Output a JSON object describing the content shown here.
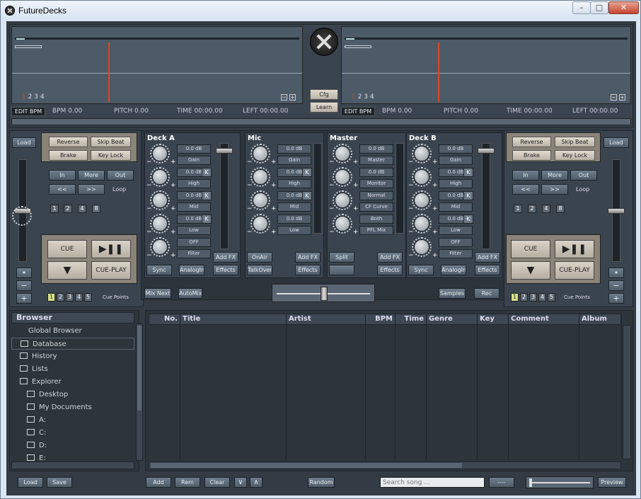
{
  "window": {
    "title": "FutureDecks",
    "min": "–",
    "max": "□",
    "close": "✕"
  },
  "center": {
    "cfg": "Cfg",
    "learn": "Learn"
  },
  "deckLeft": {
    "wave_nums": [
      "1",
      "2",
      "3",
      "4"
    ],
    "edit_bpm": "EDIT BPM",
    "bpm": "BPM  0.00",
    "pitch": "PITCH  0.00",
    "time": "TIME  00:00.00",
    "left": "LEFT  00:00.00",
    "load": "Load",
    "reverse": "Reverse",
    "skip_beat": "Skip Beat",
    "brake": "Brake",
    "key_lock": "Key Lock",
    "in": "In",
    "more": "More",
    "out": "Out",
    "back": "<<",
    "fwd": ">>",
    "loop": "Loop",
    "loops": [
      "1",
      "2",
      "4",
      "8"
    ],
    "cue": "CUE",
    "play": "▶❚❚",
    "stop": "▼",
    "cue_play": "CUE-PLAY",
    "cues": [
      "1",
      "2",
      "3",
      "4",
      "5"
    ],
    "cue_points": "Cue Points",
    "pitch_dot": "•",
    "minus": "−",
    "plus": "+"
  },
  "deckRight": {
    "wave_nums": [
      "1",
      "2",
      "3",
      "4"
    ],
    "edit_bpm": "EDIT BPM",
    "bpm": "BPM  0.00",
    "pitch": "PITCH  0.00",
    "time": "TIME  00:00.00",
    "left": "LEFT  00:00.00",
    "load": "Load",
    "reverse": "Reverse",
    "skip_beat": "Skip Beat",
    "brake": "Brake",
    "key_lock": "Key Lock",
    "in": "In",
    "more": "More",
    "out": "Out",
    "back": "<<",
    "fwd": ">>",
    "loop": "Loop",
    "loops": [
      "1",
      "2",
      "4",
      "8"
    ],
    "cue": "CUE",
    "play": "▶❚❚",
    "stop": "▼",
    "cue_play": "CUE-PLAY",
    "cues": [
      "1",
      "2",
      "3",
      "4",
      "5"
    ],
    "cue_points": "Cue Points",
    "pitch_dot": "•",
    "minus": "−",
    "plus": "+"
  },
  "mixer": {
    "deckA": {
      "title": "Deck A",
      "rows": [
        {
          "val": "0.0 dB",
          "lbl": "Gain"
        },
        {
          "val": "0.0 dB",
          "lbl": "High",
          "k": "K"
        },
        {
          "val": "0.0 dB",
          "lbl": "Mid",
          "k": "K"
        },
        {
          "val": "0.0 dB",
          "lbl": "Low",
          "k": "K"
        },
        {
          "val": "OFF",
          "lbl": "Filter"
        }
      ],
      "add_fx": "Add FX",
      "sync": "Sync",
      "analogin": "AnalogIn",
      "effects": "Effects"
    },
    "mic": {
      "title": "Mic",
      "rows": [
        {
          "val": "0.0 dB",
          "lbl": "Gain"
        },
        {
          "val": "0.0 dB",
          "lbl": "High",
          "k": "K"
        },
        {
          "val": "0.0 dB",
          "lbl": "Mid",
          "k": "K"
        },
        {
          "val": "0.0 dB",
          "lbl": "Low"
        }
      ],
      "onair": "OnAir",
      "add_fx": "Add FX",
      "talkover": "TalkOver",
      "effects": "Effects"
    },
    "master": {
      "title": "Master",
      "rows": [
        {
          "val": "0.0 dB",
          "lbl": "Master"
        },
        {
          "val": "0.0 dB",
          "lbl": "Monitor"
        },
        {
          "val": "Normal",
          "lbl": "CF Curve"
        },
        {
          "val": "Both",
          "lbl": "PFL Mix"
        }
      ],
      "split": "Split",
      "add_fx": "Add FX",
      "effects": "Effects"
    },
    "deckB": {
      "title": "Deck B",
      "rows": [
        {
          "val": "0.0 dB",
          "lbl": "Gain"
        },
        {
          "val": "0.0 dB",
          "lbl": "High",
          "k": "K"
        },
        {
          "val": "0.0 dB",
          "lbl": "Mid",
          "k": "K"
        },
        {
          "val": "0.0 dB",
          "lbl": "Low",
          "k": "K"
        },
        {
          "val": "OFF",
          "lbl": "Filter"
        }
      ],
      "add_fx": "Add FX",
      "sync": "Sync",
      "analogin": "AnalogIn",
      "effects": "Effects"
    },
    "mix_next": "Mix Next",
    "automix": "AutoMix",
    "samples": "Samples",
    "rec": "Rec"
  },
  "browser": {
    "header": "Browser",
    "items": [
      {
        "label": "Global Browser"
      },
      {
        "label": "Database"
      },
      {
        "label": "History"
      },
      {
        "label": "Lists"
      },
      {
        "label": "Explorer"
      },
      {
        "label": "Desktop"
      },
      {
        "label": "My Documents"
      },
      {
        "label": "A:"
      },
      {
        "label": "C:"
      },
      {
        "label": "D:"
      },
      {
        "label": "E:"
      }
    ]
  },
  "table": {
    "columns": [
      "No.",
      "Title",
      "Artist",
      "BPM",
      "Time",
      "Genre",
      "Key",
      "Comment",
      "Album"
    ]
  },
  "bottom": {
    "load": "Load",
    "save": "Save",
    "add": "Add",
    "rem": "Rem",
    "clear": "Clear",
    "down": "∨",
    "up": "∧",
    "random": "Random",
    "search_placeholder": "Search song ...",
    "dashes": "----",
    "preview": "Preview"
  }
}
